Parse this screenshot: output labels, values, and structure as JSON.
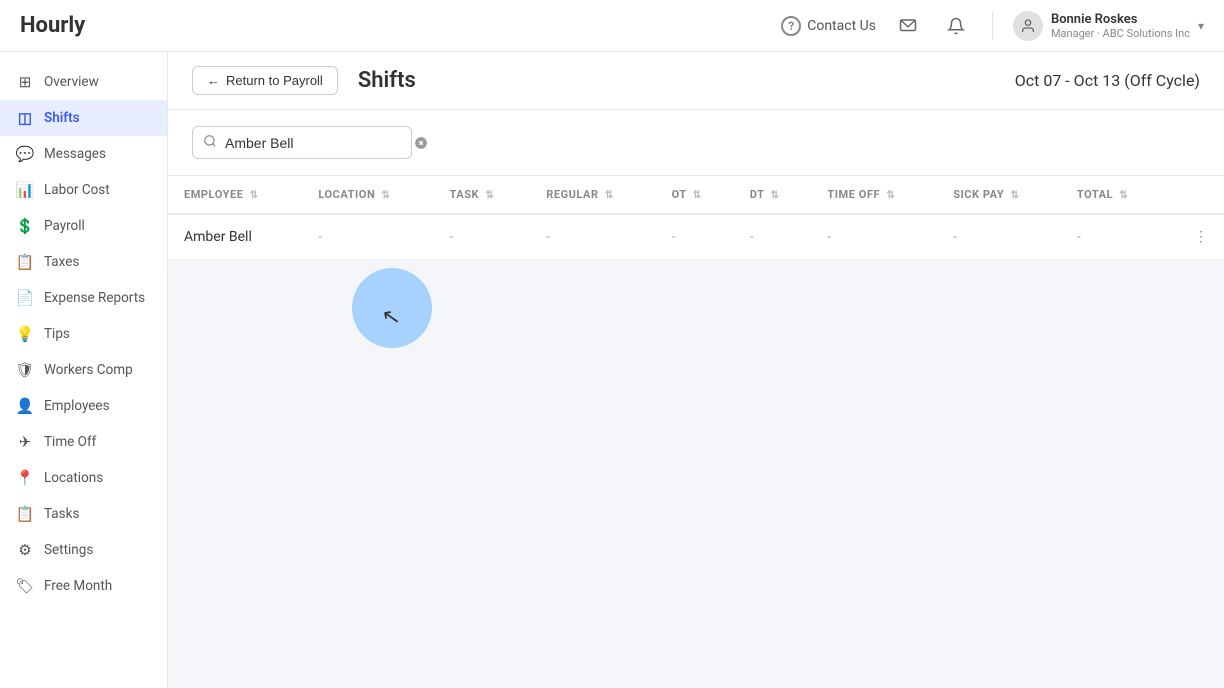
{
  "app": {
    "logo": "Hourly"
  },
  "topnav": {
    "contact_label": "Contact Us",
    "user_name": "Bonnie Roskes",
    "user_role": "Manager · ABC Solutions Inc",
    "chevron": "▾"
  },
  "sidebar": {
    "items": [
      {
        "id": "overview",
        "label": "Overview",
        "icon": "⊞",
        "active": false
      },
      {
        "id": "shifts",
        "label": "Shifts",
        "icon": "◫",
        "active": true
      },
      {
        "id": "messages",
        "label": "Messages",
        "icon": "💬",
        "active": false
      },
      {
        "id": "labor-cost",
        "label": "Labor Cost",
        "icon": "📊",
        "active": false
      },
      {
        "id": "payroll",
        "label": "Payroll",
        "icon": "💲",
        "active": false
      },
      {
        "id": "taxes",
        "label": "Taxes",
        "icon": "📋",
        "active": false
      },
      {
        "id": "expense-reports",
        "label": "Expense Reports",
        "icon": "📄",
        "active": false
      },
      {
        "id": "tips",
        "label": "Tips",
        "icon": "💡",
        "active": false
      },
      {
        "id": "workers-comp",
        "label": "Workers Comp",
        "icon": "🛡",
        "active": false
      },
      {
        "id": "employees",
        "label": "Employees",
        "icon": "👤",
        "active": false
      },
      {
        "id": "time-off",
        "label": "Time Off",
        "icon": "✈",
        "active": false
      },
      {
        "id": "locations",
        "label": "Locations",
        "icon": "📍",
        "active": false
      },
      {
        "id": "tasks",
        "label": "Tasks",
        "icon": "📋",
        "active": false
      },
      {
        "id": "settings",
        "label": "Settings",
        "icon": "⚙",
        "active": false
      },
      {
        "id": "free-month",
        "label": "Free Month",
        "icon": "🏷",
        "active": false
      }
    ]
  },
  "page_header": {
    "return_label": "Return to Payroll",
    "title": "Shifts",
    "date_range": "Oct 07 - Oct 13 (Off Cycle)"
  },
  "search": {
    "placeholder": "Search...",
    "current_value": "Amber Bell"
  },
  "table": {
    "columns": [
      {
        "id": "employee",
        "label": "EMPLOYEE"
      },
      {
        "id": "location",
        "label": "LOCATION"
      },
      {
        "id": "task",
        "label": "TASK"
      },
      {
        "id": "regular",
        "label": "REGULAR"
      },
      {
        "id": "ot",
        "label": "OT"
      },
      {
        "id": "dt",
        "label": "DT"
      },
      {
        "id": "time_off",
        "label": "TIME OFF"
      },
      {
        "id": "sick_pay",
        "label": "SICK PAY"
      },
      {
        "id": "total",
        "label": "TOTAL"
      }
    ],
    "rows": [
      {
        "employee": "Amber Bell",
        "location": "-",
        "task": "-",
        "regular": "-",
        "ot": "-",
        "dt": "-",
        "time_off": "-",
        "sick_pay": "-",
        "total": "-"
      }
    ]
  }
}
